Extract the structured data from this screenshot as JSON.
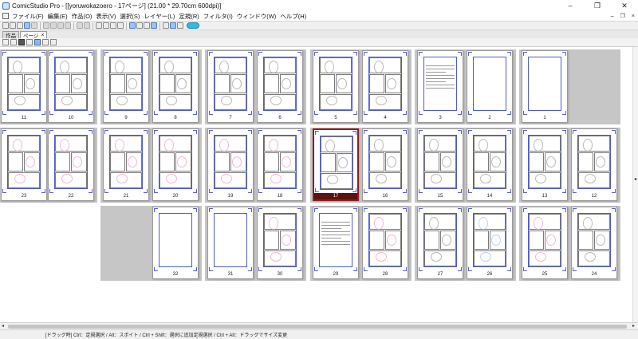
{
  "window": {
    "title": "ComicStudio Pro - [[yoruwokazoero - 17ページ] (21.00 * 29.70cm 600dpi)]",
    "minimize_icon": "minimize-icon",
    "maximize_icon": "restore-icon",
    "close_icon": "close-icon"
  },
  "menubar": {
    "items": [
      "ファイル(F)",
      "編集(E)",
      "作品(O)",
      "表示(V)",
      "選択(S)",
      "レイヤー(L)",
      "定規(R)",
      "フィルタ(I)",
      "ウィンドウ(W)",
      "ヘルプ(H)"
    ],
    "mdi_minimize": "–",
    "mdi_restore": "❐",
    "mdi_close": "×"
  },
  "tabs": [
    {
      "label": "作品",
      "active": false
    },
    {
      "label": "ページ",
      "active": true,
      "close": "×"
    }
  ],
  "pages": {
    "row1": [
      {
        "num": "11",
        "type": "manga"
      },
      {
        "num": "10",
        "type": "manga"
      },
      {
        "num": "9",
        "type": "manga"
      },
      {
        "num": "8",
        "type": "manga"
      },
      {
        "num": "7",
        "type": "manga"
      },
      {
        "num": "6",
        "type": "manga"
      },
      {
        "num": "5",
        "type": "manga"
      },
      {
        "num": "4",
        "type": "manga"
      },
      {
        "num": "3",
        "type": "text"
      },
      {
        "num": "2",
        "type": "blank"
      },
      {
        "num": "1",
        "type": "blank"
      }
    ],
    "row2": [
      {
        "num": "23",
        "type": "color"
      },
      {
        "num": "22",
        "type": "color"
      },
      {
        "num": "21",
        "type": "color"
      },
      {
        "num": "20",
        "type": "color"
      },
      {
        "num": "19",
        "type": "color"
      },
      {
        "num": "18",
        "type": "color"
      },
      {
        "num": "17",
        "type": "manga",
        "selected": true
      },
      {
        "num": "16",
        "type": "manga"
      },
      {
        "num": "15",
        "type": "manga"
      },
      {
        "num": "14",
        "type": "manga"
      },
      {
        "num": "13",
        "type": "manga"
      },
      {
        "num": "12",
        "type": "manga"
      }
    ],
    "row3": [
      {
        "num": "32",
        "type": "blank"
      },
      {
        "num": "31",
        "type": "blank"
      },
      {
        "num": "30",
        "type": "color"
      },
      {
        "num": "29",
        "type": "text"
      },
      {
        "num": "28",
        "type": "color"
      },
      {
        "num": "27",
        "type": "manga"
      },
      {
        "num": "26",
        "type": "blue"
      },
      {
        "num": "25",
        "type": "color"
      },
      {
        "num": "24",
        "type": "manga"
      }
    ]
  },
  "statusbar": {
    "text": "[ドラッグ時] Ctrl：定規選択 / Alt：スポイト / Ctrl + Shift：選択に追加定規選択 / Ctrl + Alt：ドラッグでサイズ変更"
  },
  "colors": {
    "frame_blue": "#4f5cc8",
    "selected_border": "#8c1f1f",
    "sketch_pink": "#e58ac6",
    "sketch_blue": "#8fb6ea"
  }
}
